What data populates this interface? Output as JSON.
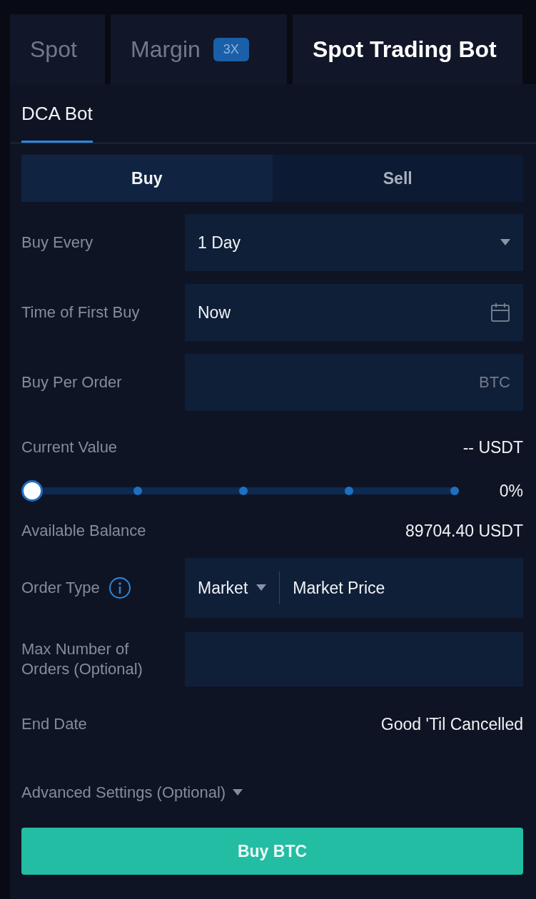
{
  "tabs": [
    {
      "label": "Spot",
      "selected": false
    },
    {
      "label": "Margin",
      "badge": "3X",
      "selected": false
    },
    {
      "label": "Spot Trading Bot",
      "selected": true
    }
  ],
  "sub_tabs": [
    {
      "label": "DCA Bot",
      "selected": true
    }
  ],
  "sides": [
    {
      "label": "Buy",
      "selected": true
    },
    {
      "label": "Sell",
      "selected": false
    }
  ],
  "form": [
    {
      "kind": "select",
      "label": "Buy Every",
      "value": "1 Day"
    },
    {
      "kind": "date",
      "label": "Time of First Buy",
      "value": "Now"
    },
    {
      "kind": "input",
      "label": "Buy Per Order",
      "suffix": "BTC"
    }
  ],
  "current_value": {
    "label": "Current Value",
    "value": "-- USDT"
  },
  "slider": {
    "level": 0,
    "reading": "0%"
  },
  "available_balance": {
    "label": "Available Balance",
    "value": "89704.40 USDT"
  },
  "order_type": {
    "label": "Order Type",
    "type": "Market",
    "price": "Market Price"
  },
  "max_orders": {
    "label": "Max Number of Orders (Optional)"
  },
  "end_date": {
    "label": "End Date",
    "value": "Good 'Til Cancelled"
  },
  "advanced": {
    "label": "Advanced Settings (Optional)",
    "expanded": false
  },
  "submit": "Buy BTC"
}
